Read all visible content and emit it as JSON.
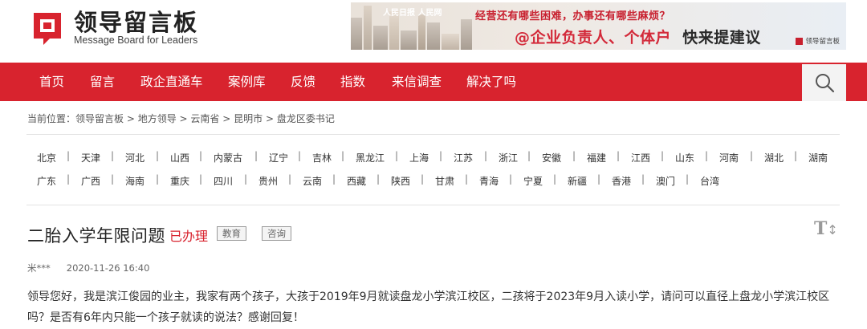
{
  "logo": {
    "title": "领导留言板",
    "subtitle": "Message Board for Leaders"
  },
  "banner": {
    "brands": "人民日报 人民网",
    "line1": "经营还有哪些困难，办事还有哪些麻烦？",
    "line2_red": "@企业负责人、个体户",
    "line2_dark": "快来提建议",
    "footer": "领导留言板"
  },
  "nav": {
    "items": [
      "首页",
      "留言",
      "政企直通车",
      "案例库",
      "反馈",
      "指数",
      "来信调查",
      "解决了吗"
    ],
    "search_icon": "search-icon"
  },
  "breadcrumb": {
    "label": "当前位置：",
    "path": [
      "领导留言板",
      "地方领导",
      "云南省",
      "昆明市",
      "盘龙区委书记"
    ],
    "separator": " > "
  },
  "regions": {
    "row1": [
      "北京",
      "天津",
      "河北",
      "山西",
      "内蒙古",
      "辽宁",
      "吉林",
      "黑龙江",
      "上海",
      "江苏",
      "浙江",
      "安徽",
      "福建",
      "江西",
      "山东",
      "河南",
      "湖北",
      "湖南"
    ],
    "row2": [
      "广东",
      "广西",
      "海南",
      "重庆",
      "四川",
      "贵州",
      "云南",
      "西藏",
      "陕西",
      "甘肃",
      "青海",
      "宁夏",
      "新疆",
      "香港",
      "澳门",
      "台湾"
    ]
  },
  "message": {
    "title": "二胎入学年限问题",
    "status": "已办理",
    "tags": [
      "教育",
      "咨询"
    ],
    "author": "米***",
    "date": "2020-11-26 16:40",
    "body": "领导您好，我是滨江俊园的业主，我家有两个孩子，大孩于2019年9月就读盘龙小学滨江校区，二孩将于2023年9月入读小学，请问可以直径上盘龙小学滨江校区吗？是否有6年内只能一个孩子就读的说法？感谢回复！"
  },
  "colors": {
    "brand_red": "#d8232e",
    "status_red": "#d8232e"
  }
}
